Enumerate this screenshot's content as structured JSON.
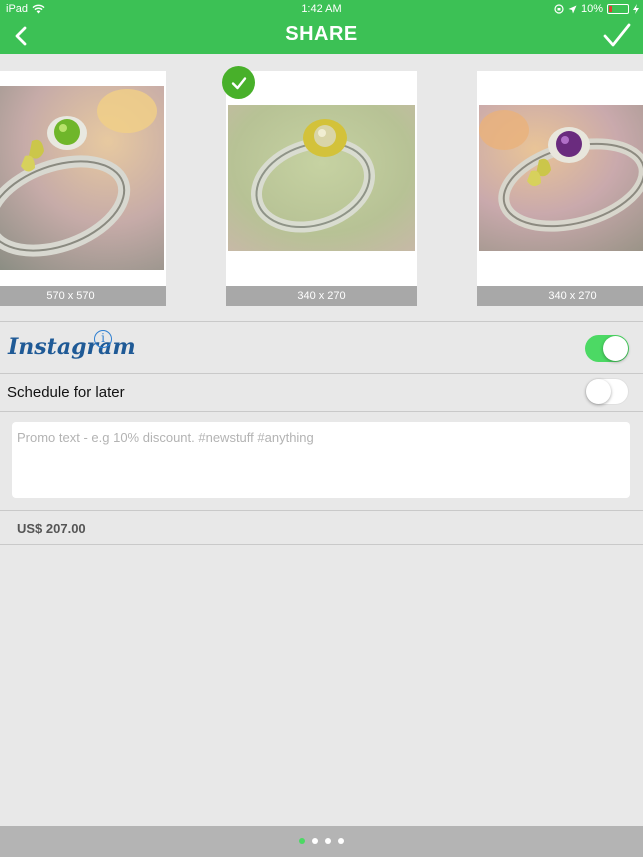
{
  "status_bar": {
    "device": "iPad",
    "time": "1:42 AM",
    "battery": "10%"
  },
  "nav": {
    "title": "SHARE",
    "back_icon": "chevron-left-icon",
    "done_icon": "checkmark-icon"
  },
  "images": [
    {
      "dims": "570 x 570",
      "gem": "green peridot",
      "selected": false
    },
    {
      "dims": "340 x 270",
      "gem": "yellow citrine",
      "selected": true
    },
    {
      "dims": "340 x 270",
      "gem": "purple amethyst",
      "selected": false
    }
  ],
  "instagram": {
    "label": "Instagram",
    "info_glyph": "i",
    "enabled": true
  },
  "schedule": {
    "label": "Schedule for later",
    "enabled": false
  },
  "promo": {
    "placeholder": "Promo text - e.g 10% discount. #newstuff #anything",
    "value": ""
  },
  "price": "US$ 207.00",
  "pager": {
    "count": 4,
    "active_index": 0
  },
  "colors": {
    "brand_green": "#3cc155",
    "toggle_on": "#4cd964",
    "instagram_blue": "#1f5a96",
    "selected_badge": "#48b02a"
  }
}
